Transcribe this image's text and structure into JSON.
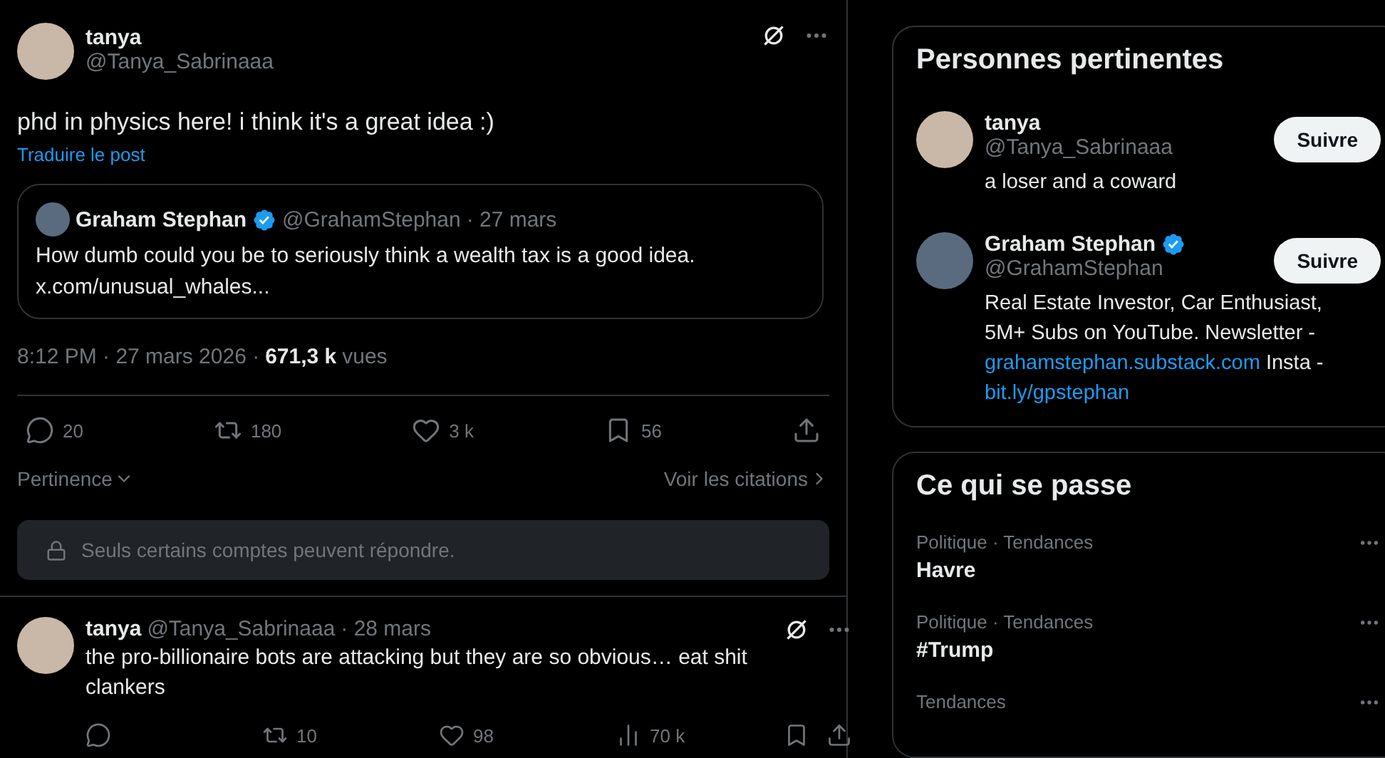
{
  "main_post": {
    "author": {
      "name": "tanya",
      "handle": "@Tanya_Sabrinaaa",
      "verified": false
    },
    "text": "phd in physics here! i think it's a great idea :)",
    "translate": "Traduire le post",
    "quote": {
      "name": "Graham Stephan",
      "verified": true,
      "handle": "@GrahamStephan",
      "date": "· 27 mars",
      "text": "How dumb could you be to seriously think a wealth tax is a good idea.",
      "link": "x.com/unusual_whales..."
    },
    "timestamp": "8:12 PM · 27 mars 2026 ·",
    "views": "671,3 k",
    "views_label": "vues",
    "stats": [
      {
        "kind": "reply",
        "count": "20"
      },
      {
        "kind": "repost",
        "count": "180"
      },
      {
        "kind": "like",
        "count": "3 k"
      },
      {
        "kind": "bookmark",
        "count": "56"
      },
      {
        "kind": "share"
      }
    ]
  },
  "reply_controls": {
    "sort": "Pertinence",
    "quotes": "Voir les citations"
  },
  "reply_notice": "Seuls certains comptes peuvent répondre.",
  "replies": [
    {
      "name": "tanya",
      "handle": "@Tanya_Sabrinaaa",
      "date": "· 28 mars",
      "text": "the pro-billionaire bots are attacking but they are so obvious… eat shit clankers",
      "stats": [
        {
          "kind": "reply"
        },
        {
          "kind": "repost",
          "count": "10"
        },
        {
          "kind": "like",
          "count": "98"
        },
        {
          "kind": "views",
          "count": "70 k"
        },
        {
          "kind": "bookmark"
        },
        {
          "kind": "share"
        }
      ]
    }
  ],
  "relevant_people": {
    "title": "Personnes pertinentes",
    "people": [
      {
        "name": "tanya",
        "verified": false,
        "handle": "@Tanya_Sabrinaaa",
        "button": "Suivre",
        "bio": [
          {
            "kind": "text",
            "text": "a loser and a coward"
          }
        ]
      },
      {
        "name": "Graham Stephan",
        "verified": true,
        "handle": "@GrahamStephan",
        "button": "Suivre",
        "bio": [
          {
            "kind": "text",
            "text": "Real Estate Investor, Car Enthusiast, 5M+ Subs on YouTube. Newsletter - "
          },
          {
            "kind": "link",
            "text": "grahamstephan.substack.com"
          },
          {
            "kind": "text",
            "text": " Insta - "
          },
          {
            "kind": "link",
            "text": "bit.ly/gpstephan"
          }
        ]
      }
    ]
  },
  "trending": {
    "title": "Ce qui se passe",
    "items": [
      {
        "context": "Politique · Tendances",
        "name": "Havre"
      },
      {
        "context": "Politique · Tendances",
        "name": "#Trump"
      },
      {
        "context": "Tendances"
      }
    ]
  }
}
